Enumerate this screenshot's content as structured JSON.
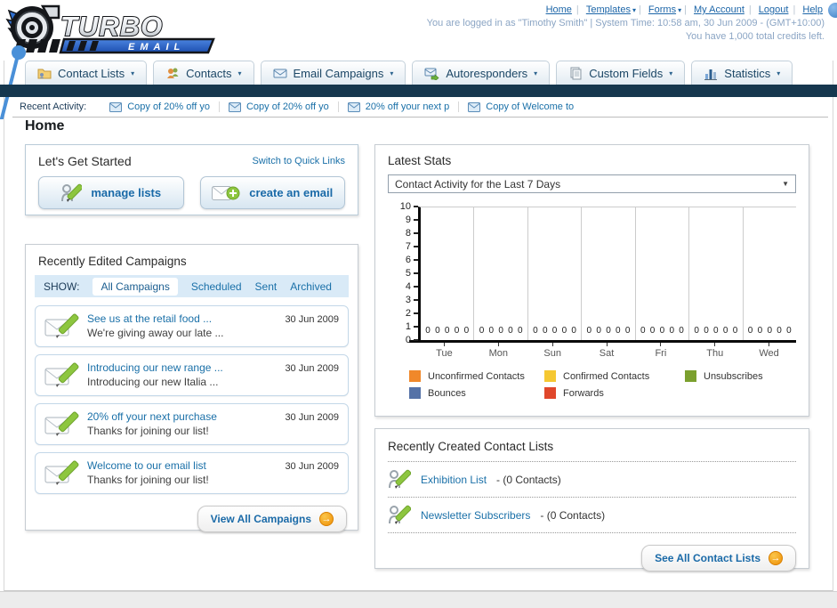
{
  "glyphs": {
    "dropdown_arrow": "▾",
    "select_arrow": "▼",
    "forward_arrow": "→",
    "separator": "|"
  },
  "colors": {
    "navy_bar": "#16374e",
    "link_blue": "#1a70a8",
    "button_text_blue": "#1a6aa8",
    "arrow_button_orange": "#ee8f06",
    "logo_banner_blue": "#2563c4",
    "decor_ball_blue": "#4a90d8",
    "show_bar_blue": "#d9eaf7"
  },
  "header": {
    "logo_title": "TURBO",
    "logo_subtitle": "EMAIL",
    "links": [
      {
        "label": "Home",
        "dropdown": false
      },
      {
        "label": "Templates",
        "dropdown": true
      },
      {
        "label": "Forms",
        "dropdown": true
      },
      {
        "label": "My Account",
        "dropdown": false
      },
      {
        "label": "Logout",
        "dropdown": false
      },
      {
        "label": "Help",
        "dropdown": false
      }
    ],
    "login_info": "You are logged in as \"Timothy Smith\" | System Time: 10:58 am, 30 Jun 2009 - (GMT+10:00)",
    "credits_info": "You have 1,000 total credits left."
  },
  "nav_tabs": [
    {
      "label": "Contact Lists",
      "icon": "contact-lists-icon"
    },
    {
      "label": "Contacts",
      "icon": "contacts-icon"
    },
    {
      "label": "Email Campaigns",
      "icon": "email-campaigns-icon"
    },
    {
      "label": "Autoresponders",
      "icon": "autoresponders-icon"
    },
    {
      "label": "Custom Fields",
      "icon": "custom-fields-icon"
    },
    {
      "label": "Statistics",
      "icon": "statistics-icon"
    }
  ],
  "recent_activity": {
    "label": "Recent Activity:",
    "items": [
      "Copy of 20% off yo",
      "Copy of 20% off yo",
      "20% off your next p",
      "Copy of Welcome to"
    ]
  },
  "main": {
    "page_title": "Home"
  },
  "get_started": {
    "title": "Let's Get Started",
    "switch_link": "Switch to Quick Links",
    "manage_lists_label": "manage lists",
    "create_email_label": "create an email"
  },
  "campaigns": {
    "title": "Recently Edited Campaigns",
    "show_label": "SHOW:",
    "filters": [
      "All Campaigns",
      "Scheduled",
      "Sent",
      "Archived"
    ],
    "active_filter": "All Campaigns",
    "items": [
      {
        "title": "See us at the retail food ...",
        "subtitle": "We're giving away our late ...",
        "date": "30 Jun 2009"
      },
      {
        "title": "Introducing our new range ...",
        "subtitle": "Introducing our new Italia ...",
        "date": "30 Jun 2009"
      },
      {
        "title": "20% off your next purchase",
        "subtitle": "Thanks for joining our list!",
        "date": "30 Jun 2009"
      },
      {
        "title": "Welcome to our email list",
        "subtitle": "Thanks for joining our list!",
        "date": "30 Jun 2009"
      }
    ],
    "view_all_label": "View All Campaigns"
  },
  "latest_stats": {
    "title": "Latest Stats",
    "dropdown_value": "Contact Activity for the Last 7 Days"
  },
  "chart_data": {
    "type": "bar",
    "title": "Contact Activity for the Last 7 Days",
    "categories": [
      "Tue",
      "Mon",
      "Sun",
      "Sat",
      "Fri",
      "Thu",
      "Wed"
    ],
    "series": [
      {
        "name": "Unconfirmed Contacts",
        "color": "#f0882a",
        "values": [
          0,
          0,
          0,
          0,
          0,
          0,
          0
        ]
      },
      {
        "name": "Confirmed Contacts",
        "color": "#f5c832",
        "values": [
          0,
          0,
          0,
          0,
          0,
          0,
          0
        ]
      },
      {
        "name": "Unsubscribes",
        "color": "#7ba02e",
        "values": [
          0,
          0,
          0,
          0,
          0,
          0,
          0
        ]
      },
      {
        "name": "Bounces",
        "color": "#5572a7",
        "values": [
          0,
          0,
          0,
          0,
          0,
          0,
          0
        ]
      },
      {
        "name": "Forwards",
        "color": "#e0472b",
        "values": [
          0,
          0,
          0,
          0,
          0,
          0,
          0
        ]
      }
    ],
    "ylim": [
      0,
      10
    ],
    "ytick_step": 1,
    "grid": "vertical-day-separators",
    "legend_position": "bottom"
  },
  "contact_lists": {
    "title": "Recently Created Contact Lists",
    "items": [
      {
        "name": "Exhibition List",
        "detail": "- (0 Contacts)"
      },
      {
        "name": "Newsletter Subscribers",
        "detail": "- (0 Contacts)"
      }
    ],
    "see_all_label": "See All Contact Lists"
  }
}
